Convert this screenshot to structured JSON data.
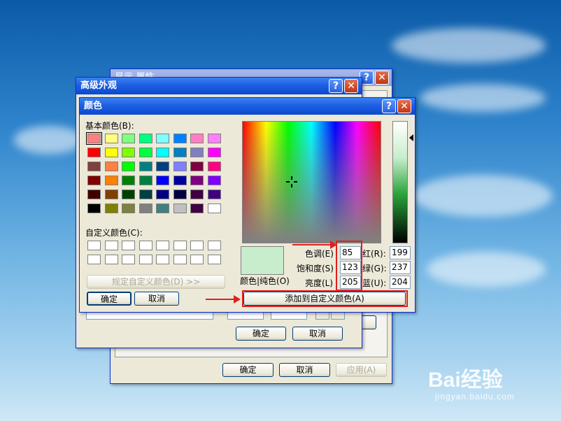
{
  "colors": {
    "swatches": [
      [
        "#ff8080",
        "#ffff80",
        "#80ff80",
        "#00ff80",
        "#80ffff",
        "#0080ff",
        "#ff80c0",
        "#ff80ff"
      ],
      [
        "#ff0000",
        "#ffff00",
        "#80ff00",
        "#00ff40",
        "#00ffff",
        "#0080c0",
        "#8080c0",
        "#ff00ff"
      ],
      [
        "#804040",
        "#ff8040",
        "#00ff00",
        "#008080",
        "#004080",
        "#8080ff",
        "#800040",
        "#ff0080"
      ],
      [
        "#800000",
        "#ff8000",
        "#008000",
        "#008040",
        "#0000ff",
        "#0000a0",
        "#800080",
        "#8000ff"
      ],
      [
        "#400000",
        "#804000",
        "#004000",
        "#004040",
        "#000080",
        "#000040",
        "#400040",
        "#400080"
      ],
      [
        "#000000",
        "#808000",
        "#808040",
        "#808080",
        "#408080",
        "#c0c0c0",
        "#400040",
        "#ffffff"
      ]
    ],
    "solid_preview": "#c7edcc"
  },
  "back_dialog": {
    "title_fragment": "显示 属性",
    "ok": "确定",
    "cancel": "取消",
    "apply": "应用(A)"
  },
  "advanced_dialog": {
    "title": "高级外观",
    "ok": "确定",
    "cancel": "取消"
  },
  "color_dialog": {
    "title": "颜色",
    "basic_colors_label": "基本颜色(B):",
    "custom_colors_label": "自定义颜色(C):",
    "define_custom_button": "规定自定义颜色(D) >>",
    "ok": "确定",
    "cancel": "取消",
    "color_solid_label": "颜色|纯色(O)",
    "hue_label": "色调(E)",
    "saturation_label": "饱和度(S)",
    "luminance_label": "亮度(L)",
    "red_label": "红(R):",
    "green_label": "绿(G):",
    "blue_label": "蓝(U):",
    "hue": "85",
    "saturation": "123",
    "luminance": "205",
    "red": "199",
    "green": "237",
    "blue": "204",
    "add_custom_button": "添加到自定义颜色(A)"
  },
  "watermark": {
    "brand": "Bai经验",
    "url": "jingyan.baidu.com"
  }
}
